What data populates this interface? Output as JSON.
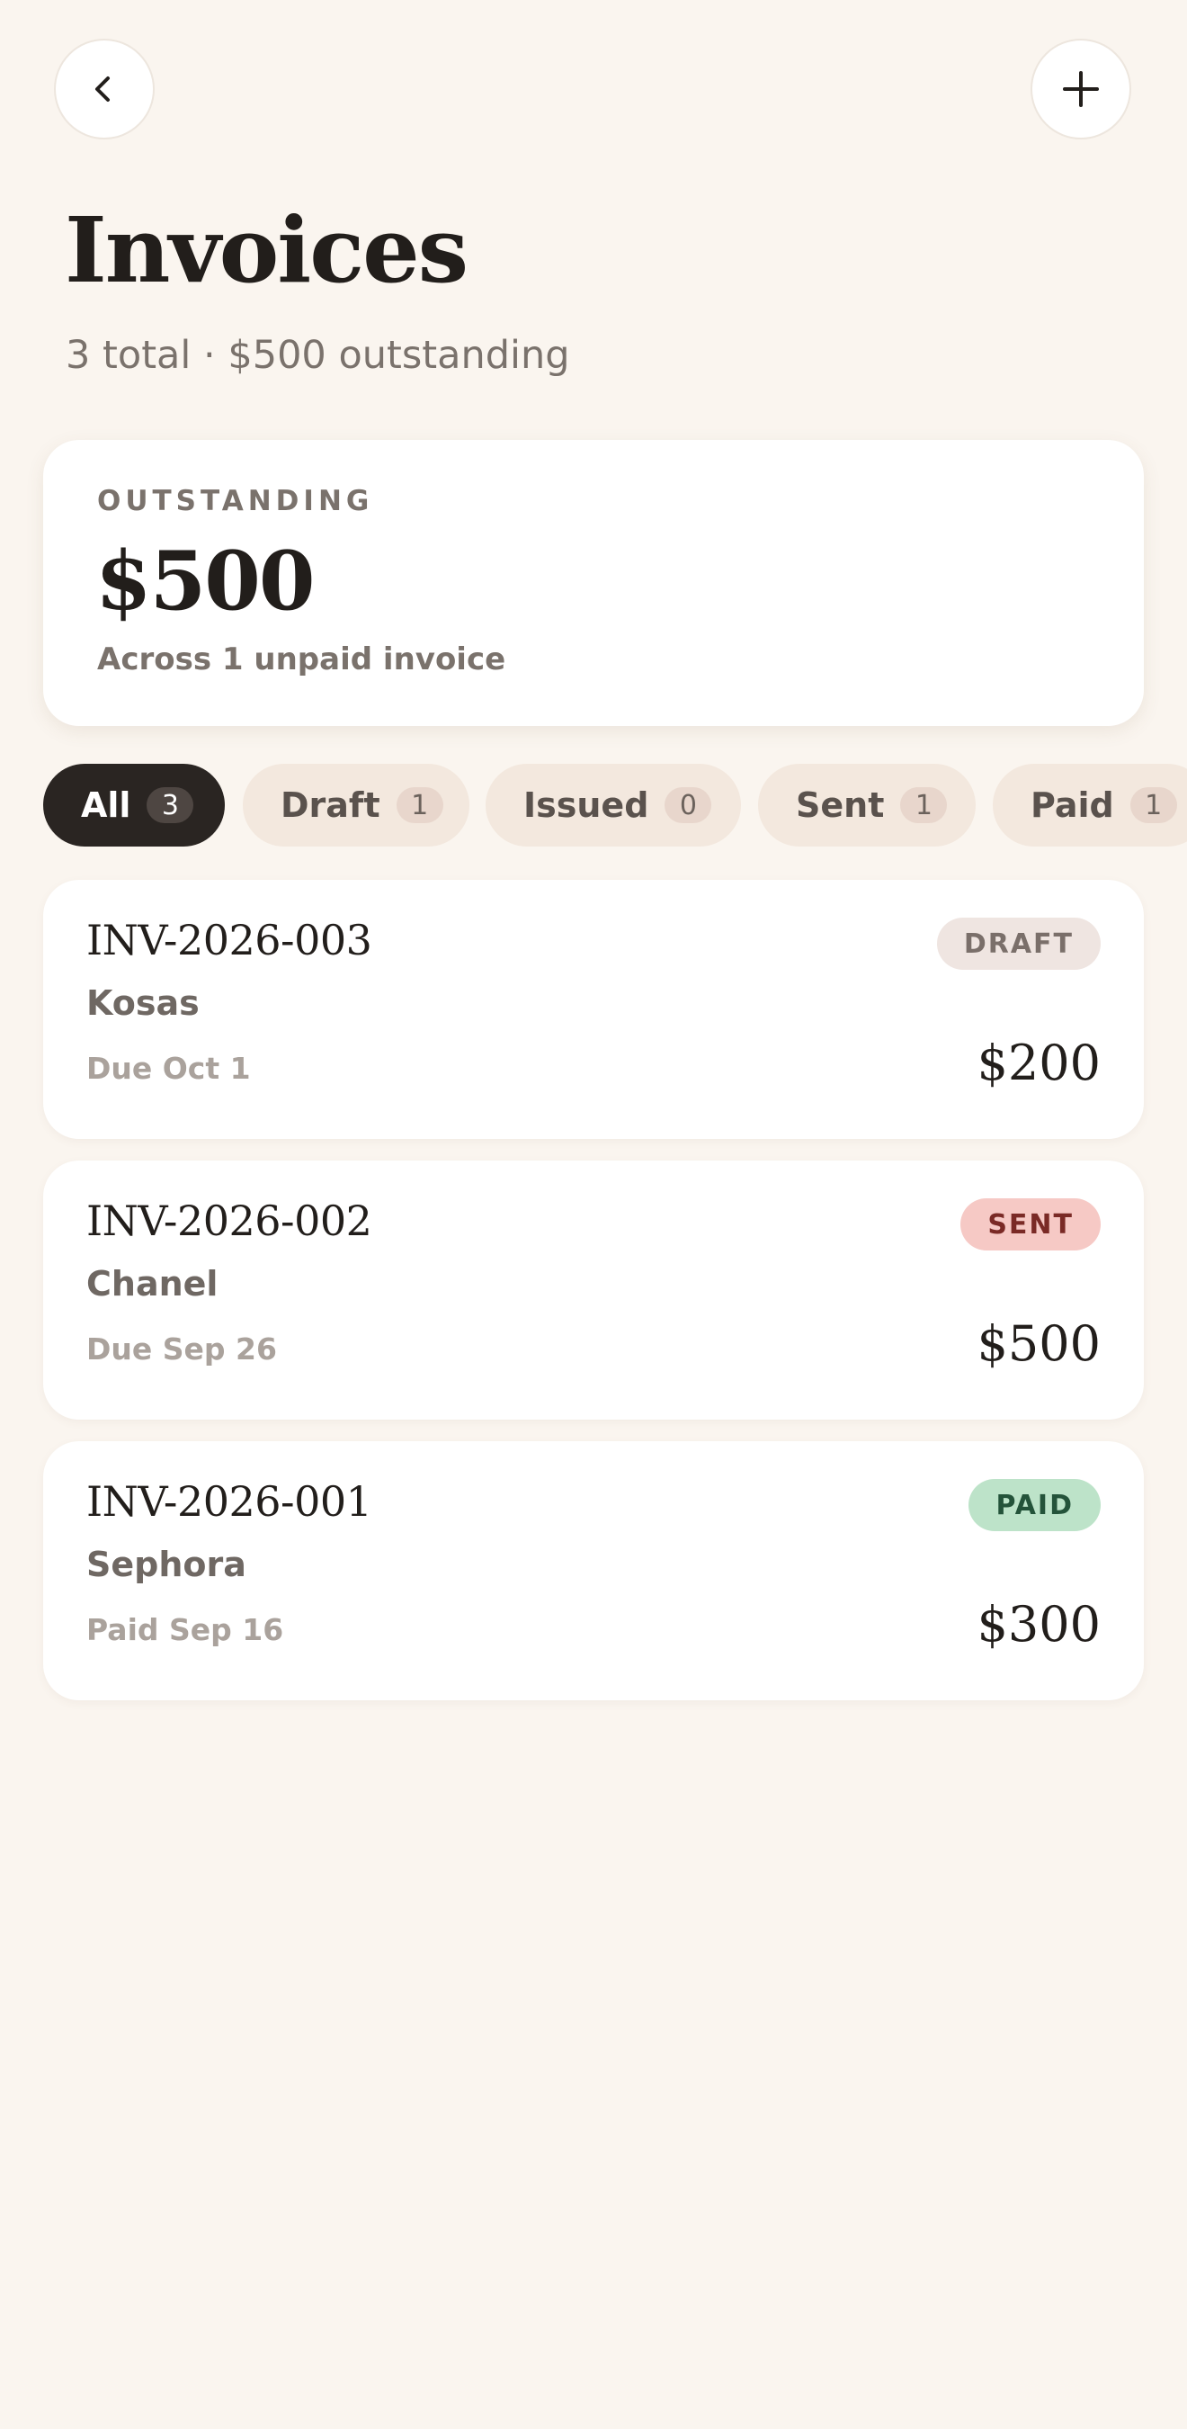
{
  "header": {
    "back_icon": "chevron-left-icon",
    "add_icon": "plus-icon",
    "title": "Invoices",
    "subtitle": "3 total · $500 outstanding"
  },
  "summary": {
    "label": "OUTSTANDING",
    "amount": "$500",
    "note": "Across 1 unpaid invoice"
  },
  "filters": [
    {
      "label": "All",
      "count": "3",
      "active": true
    },
    {
      "label": "Draft",
      "count": "1",
      "active": false
    },
    {
      "label": "Issued",
      "count": "0",
      "active": false
    },
    {
      "label": "Sent",
      "count": "1",
      "active": false
    },
    {
      "label": "Paid",
      "count": "1",
      "active": false
    }
  ],
  "invoices": [
    {
      "number": "INV-2026-003",
      "client": "Kosas",
      "due": "Due Oct 1",
      "amount": "$200",
      "status": "DRAFT",
      "status_bg": "#efe5e1",
      "status_fg": "#7a6f6a"
    },
    {
      "number": "INV-2026-002",
      "client": "Chanel",
      "due": "Due Sep 26",
      "amount": "$500",
      "status": "SENT",
      "status_bg": "#f6c9c5",
      "status_fg": "#7a2a26"
    },
    {
      "number": "INV-2026-001",
      "client": "Sephora",
      "due": "Paid Sep 16",
      "amount": "$300",
      "status": "PAID",
      "status_bg": "#bde3c9",
      "status_fg": "#24533a"
    }
  ],
  "colors": {
    "background": "#faf5ef",
    "accent_dark": "#2a2522"
  }
}
